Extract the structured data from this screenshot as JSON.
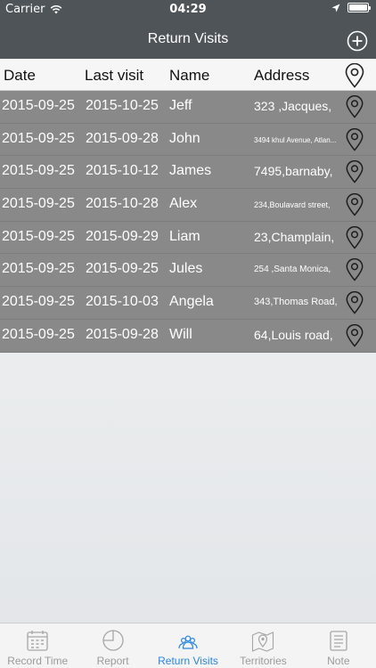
{
  "status_bar": {
    "carrier": "Carrier",
    "time": "04:29"
  },
  "nav": {
    "title": "Return Visits"
  },
  "table": {
    "columns": {
      "date": "Date",
      "last_visit": "Last visit",
      "name": "Name",
      "address": "Address"
    },
    "rows": [
      {
        "date": "2015-09-25",
        "last_visit": "2015-10-25",
        "name": "Jeff",
        "address": "323 ,Jacques,"
      },
      {
        "date": "2015-09-25",
        "last_visit": "2015-09-28",
        "name": "John",
        "address": "3494 khul Avenue, Atlan..."
      },
      {
        "date": "2015-09-25",
        "last_visit": "2015-10-12",
        "name": "James",
        "address": "7495,barnaby,"
      },
      {
        "date": "2015-09-25",
        "last_visit": "2015-10-28",
        "name": "Alex",
        "address": "234,Boulavard street,"
      },
      {
        "date": "2015-09-25",
        "last_visit": "2015-09-29",
        "name": "Liam",
        "address": "23,Champlain,"
      },
      {
        "date": "2015-09-25",
        "last_visit": "2015-09-25",
        "name": "Jules",
        "address": "254 ,Santa Monica,"
      },
      {
        "date": "2015-09-25",
        "last_visit": "2015-10-03",
        "name": "Angela",
        "address": "343,Thomas Road,"
      },
      {
        "date": "2015-09-25",
        "last_visit": "2015-09-28",
        "name": "Will",
        "address": "64,Louis road,"
      }
    ]
  },
  "tabs": [
    {
      "label": "Record Time",
      "icon": "calendar-icon"
    },
    {
      "label": "Report",
      "icon": "pie-chart-icon"
    },
    {
      "label": "Return Visits",
      "icon": "people-icon"
    },
    {
      "label": "Territories",
      "icon": "map-pin-icon"
    },
    {
      "label": "Note",
      "icon": "note-icon"
    }
  ],
  "colors": {
    "nav_bg": "#4f5458",
    "row_bg": "#898989",
    "accent": "#2a86e0",
    "tab_inactive": "#9b9b9b"
  }
}
